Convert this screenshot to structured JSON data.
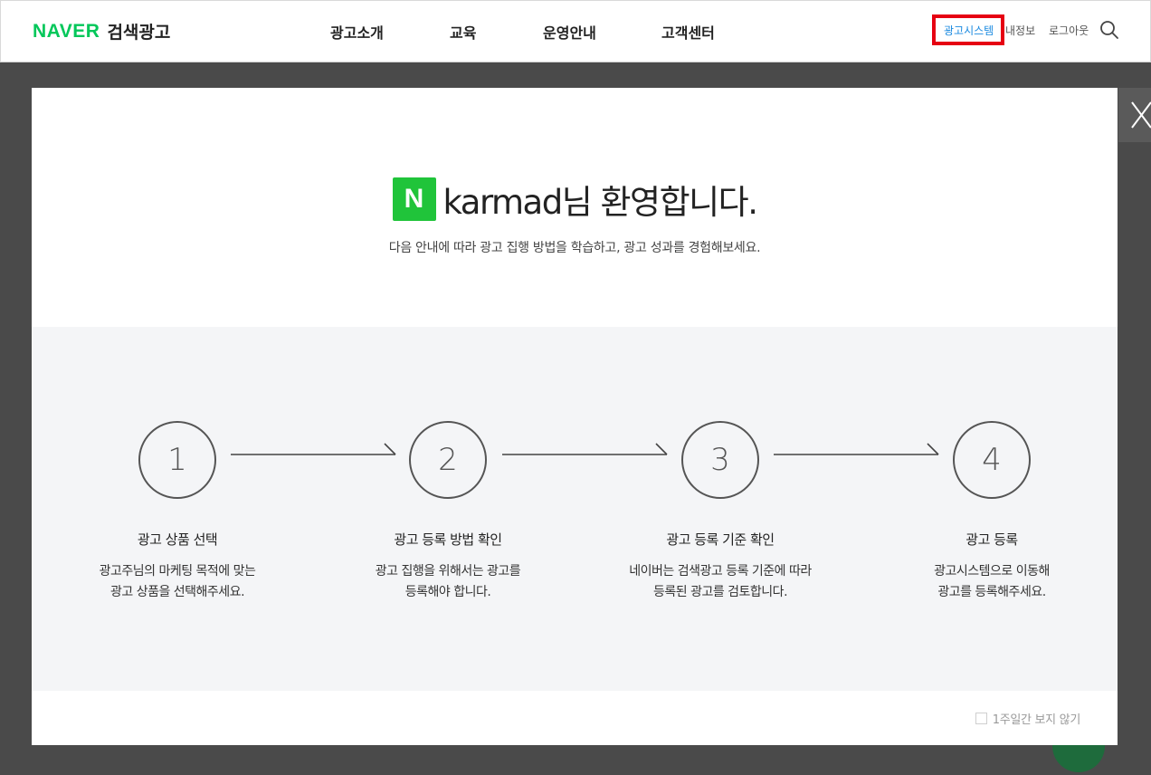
{
  "header": {
    "brand": "NAVER",
    "service": "검색광고",
    "nav": [
      "광고소개",
      "교육",
      "운영안내",
      "고객센터"
    ],
    "util": {
      "ad_system": "광고시스템",
      "my_info": "내정보",
      "logout": "로그아웃"
    }
  },
  "modal": {
    "badge": "N",
    "welcome": "karmad님 환영합니다.",
    "subtitle": "다음 안내에 따라 광고 집행 방법을 학습하고, 광고 성과를 경험해보세요.",
    "steps": [
      {
        "num": "1",
        "title": "광고 상품 선택",
        "desc1": "광고주님의 마케팅 목적에 맞는",
        "desc2": "광고 상품을 선택해주세요."
      },
      {
        "num": "2",
        "title": "광고 등록 방법 확인",
        "desc1": "광고 집행을 위해서는 광고를",
        "desc2": "등록해야 합니다."
      },
      {
        "num": "3",
        "title": "광고 등록 기준 확인",
        "desc1": "네이버는 검색광고 등록 기준에 따라",
        "desc2": "등록된 광고를 검토합니다."
      },
      {
        "num": "4",
        "title": "광고 등록",
        "desc1": "광고시스템으로 이동해",
        "desc2": "광고를 등록해주세요."
      }
    ],
    "dismiss_label": "1주일간 보지 않기"
  },
  "colors": {
    "brand_green": "#03c75a",
    "badge_green": "#20c43a",
    "active_link": "#1b8ae0",
    "highlight_red": "#e60012"
  },
  "icons": [
    "search-icon",
    "close-icon",
    "arrow-right-icon"
  ]
}
